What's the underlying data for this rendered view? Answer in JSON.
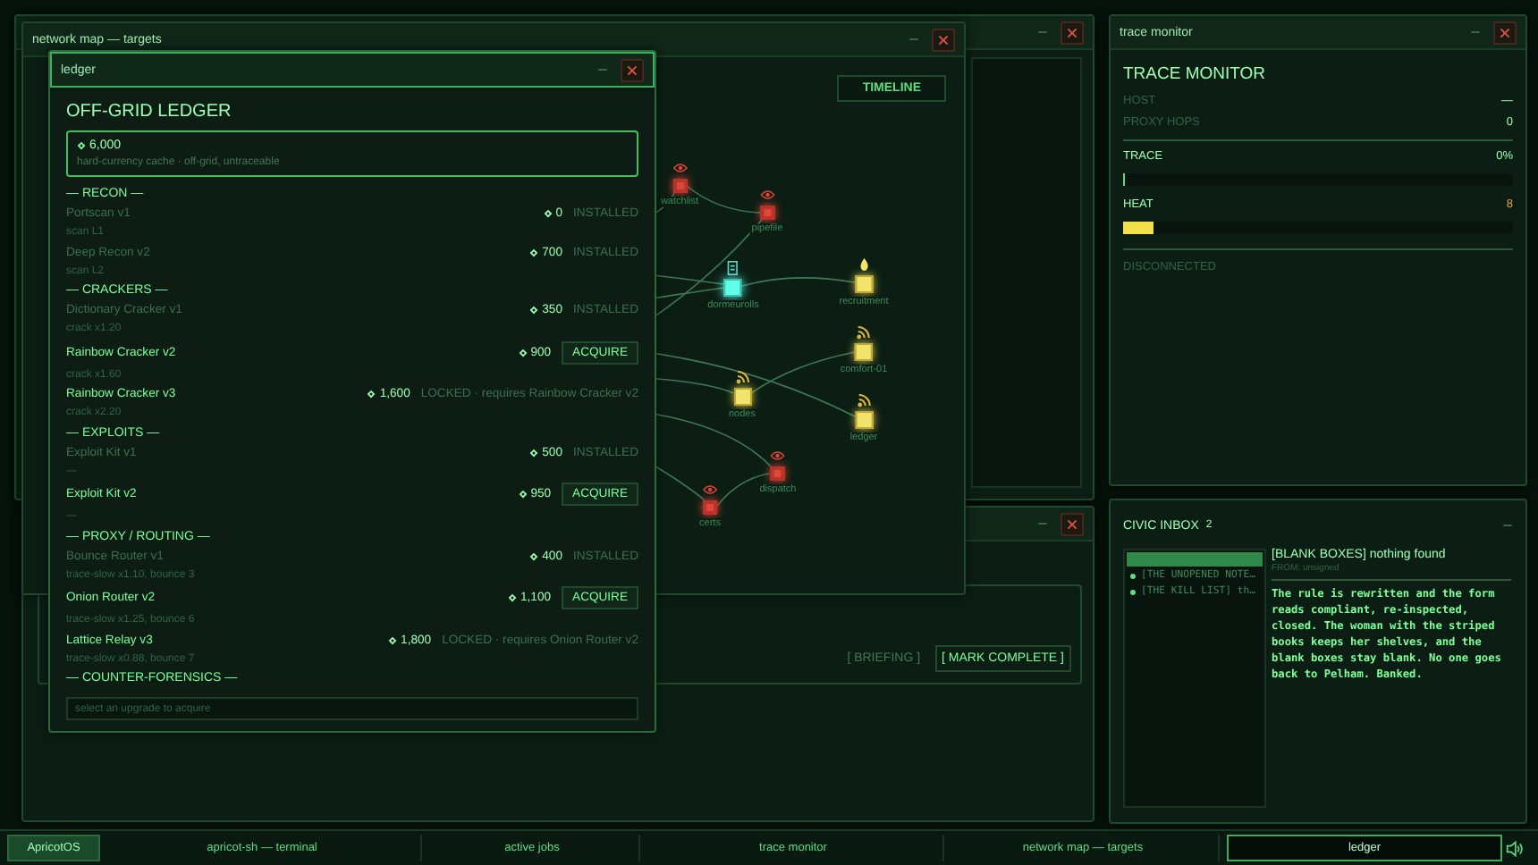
{
  "network_map": {
    "title": "network map — targets",
    "timeline_button": "TIMELINE",
    "nodes": [
      {
        "label": "watchlist",
        "kind": "watched"
      },
      {
        "label": "pipefile",
        "kind": "watched"
      },
      {
        "label": "dormeurolls",
        "kind": "current"
      },
      {
        "label": "recruitment",
        "kind": "recruit"
      },
      {
        "label": "comfort-01",
        "kind": "target"
      },
      {
        "label": "nodes",
        "kind": "target"
      },
      {
        "label": "ledger",
        "kind": "target"
      },
      {
        "label": "dispatch",
        "kind": "watched"
      },
      {
        "label": "certs",
        "kind": "watched"
      }
    ]
  },
  "jobs_window": {
    "buttons": [
      {
        "label": "[ BRIEFING ]",
        "kind": "dim"
      },
      {
        "label": "[ MARK COMPLETE ]",
        "kind": "primary"
      }
    ]
  },
  "ledger": {
    "title": "ledger",
    "heading": "OFF-GRID LEDGER",
    "balance": "6,000",
    "balance_note": "hard-currency cache · off-grid, untraceable",
    "sections": [
      {
        "title": "— RECON —",
        "items": [
          {
            "name": "Portscan v1",
            "price": "0",
            "kind": "installed",
            "status": "INSTALLED",
            "desc": "scan L1"
          },
          {
            "name": "Deep Recon v2",
            "price": "700",
            "kind": "installed",
            "status": "INSTALLED",
            "desc": "scan L2"
          }
        ]
      },
      {
        "title": "— CRACKERS —",
        "items": [
          {
            "name": "Dictionary Cracker v1",
            "price": "350",
            "kind": "installed",
            "status": "INSTALLED",
            "desc": "crack x1.20"
          },
          {
            "name": "Rainbow Cracker v2",
            "price": "900",
            "kind": "acquire",
            "status": "ACQUIRE",
            "desc": "crack x1.60"
          },
          {
            "name": "Rainbow Cracker v3",
            "price": "1,600",
            "kind": "locked",
            "status": "LOCKED · requires Rainbow Cracker v2",
            "desc": "crack x2.20"
          }
        ]
      },
      {
        "title": "— EXPLOITS —",
        "items": [
          {
            "name": "Exploit Kit v1",
            "price": "500",
            "kind": "installed",
            "status": "INSTALLED",
            "desc": "—"
          },
          {
            "name": "Exploit Kit v2",
            "price": "950",
            "kind": "acquire",
            "status": "ACQUIRE",
            "desc": "—"
          }
        ]
      },
      {
        "title": "— PROXY / ROUTING —",
        "items": [
          {
            "name": "Bounce Router v1",
            "price": "400",
            "kind": "installed",
            "status": "INSTALLED",
            "desc": "trace-slow x1.10, bounce 3"
          },
          {
            "name": "Onion Router v2",
            "price": "1,100",
            "kind": "acquire",
            "status": "ACQUIRE",
            "desc": "trace-slow x1.25, bounce 6"
          },
          {
            "name": "Lattice Relay v3",
            "price": "1,800",
            "kind": "locked",
            "status": "LOCKED · requires Onion Router v2",
            "desc": "trace-slow x0.88, bounce 7"
          }
        ]
      },
      {
        "title": "— COUNTER-FORENSICS —"
      }
    ],
    "footer_placeholder": "select an upgrade to acquire"
  },
  "trace_monitor": {
    "window_title": "trace monitor",
    "heading": "TRACE MONITOR",
    "rows": [
      {
        "label": "HOST",
        "value": "—"
      },
      {
        "label": "PROXY HOPS",
        "value": "0"
      }
    ],
    "meters": [
      {
        "label": "TRACE",
        "value": "0%",
        "kind": "trace",
        "level": 0
      },
      {
        "label": "HEAT",
        "value": "8",
        "kind": "heat",
        "level": 0.08
      }
    ],
    "status": "DISCONNECTED"
  },
  "civic_inbox": {
    "title": "CIVIC INBOX",
    "count": "2",
    "messages": [
      {
        "selected": true,
        "unread": false
      },
      {
        "text": "[THE UNOPENED NOTE…",
        "selected": false,
        "unread": true
      },
      {
        "text": "[THE KILL LIST] th…",
        "selected": false,
        "unread": true
      }
    ],
    "subject": "[BLANK BOXES] nothing found",
    "from": "FROM: unsigned",
    "body": "The rule is rewritten and the form reads compliant, re-inspected, closed. The woman with the striped books keeps her shelves, and the blank boxes stay blank. No one goes back to Pelham. Banked."
  },
  "taskbar": {
    "items": [
      {
        "label": "ApricotOS",
        "kind": "start",
        "selected": false
      },
      {
        "label": "apricot-sh — terminal",
        "kind": "task",
        "selected": false
      },
      {
        "label": "active jobs",
        "kind": "task",
        "selected": false
      },
      {
        "label": "trace monitor",
        "kind": "task",
        "selected": false
      },
      {
        "label": "network map — targets",
        "kind": "task",
        "selected": false
      },
      {
        "label": "ledger",
        "kind": "task",
        "selected": true
      }
    ]
  }
}
